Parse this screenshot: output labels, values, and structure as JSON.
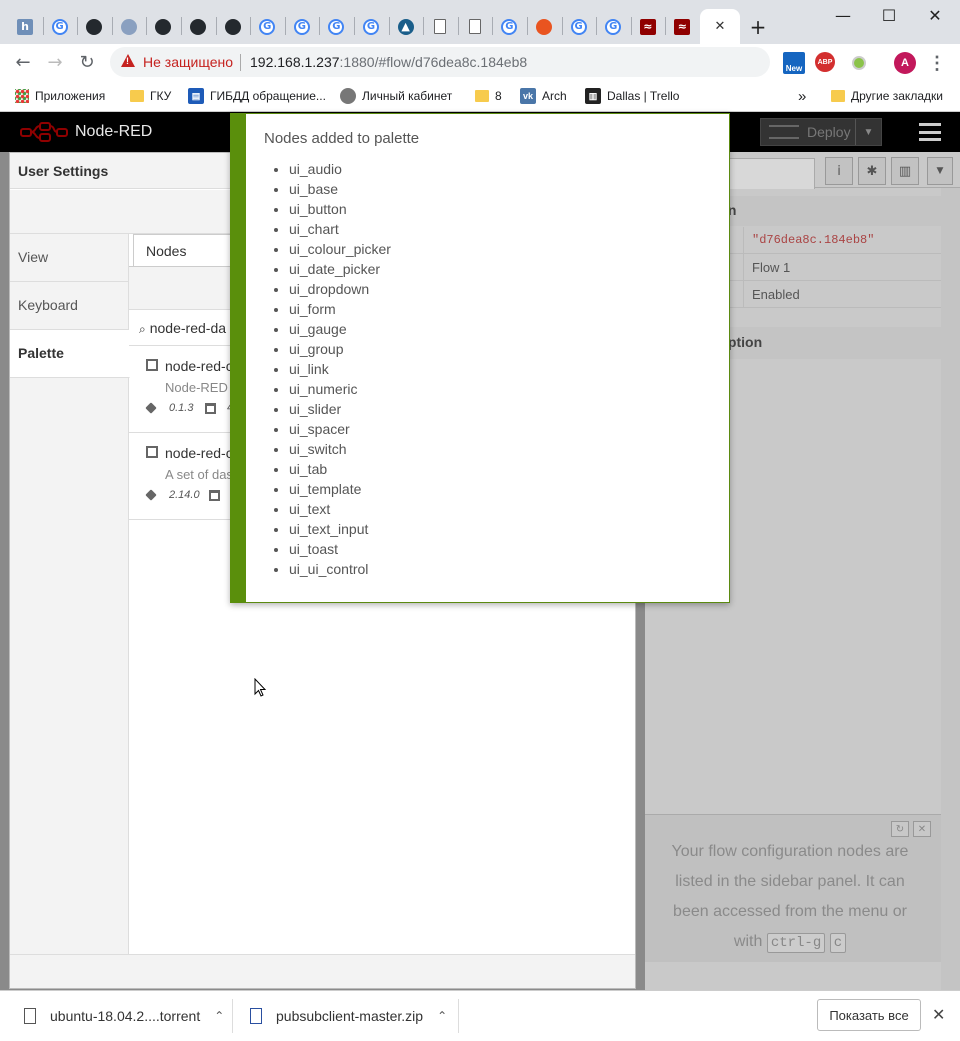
{
  "browser": {
    "tabs": [
      {
        "icon": "h-icon"
      },
      {
        "icon": "google-icon"
      },
      {
        "icon": "github-icon"
      },
      {
        "icon": "planet-icon"
      },
      {
        "icon": "github-icon"
      },
      {
        "icon": "github-icon"
      },
      {
        "icon": "github-icon"
      },
      {
        "icon": "google-icon"
      },
      {
        "icon": "google-icon"
      },
      {
        "icon": "google-icon"
      },
      {
        "icon": "google-icon"
      },
      {
        "icon": "mountain-icon"
      },
      {
        "icon": "document-icon"
      },
      {
        "icon": "document-icon"
      },
      {
        "icon": "google-icon"
      },
      {
        "icon": "ubuntu-icon"
      },
      {
        "icon": "google-icon"
      },
      {
        "icon": "google-icon"
      },
      {
        "icon": "node-red-icon"
      },
      {
        "icon": "node-red-icon"
      }
    ],
    "new_tab_symbol": "+",
    "close_tab_symbol": "✕",
    "window_controls": {
      "minimize": "—",
      "maximize": "☐",
      "close": "✕"
    },
    "security_label": "Не защищено",
    "url_host": "192.168.1.237",
    "url_rest": ":1880/#flow/d76dea8c.184eb8",
    "extension_badge_new": "New",
    "extension_abp": "ABP",
    "profile_initial": "A",
    "bookmarks": [
      {
        "label": "Приложения",
        "icon": "apps-grid-icon"
      },
      {
        "label": "ГКУ",
        "icon": "folder-icon"
      },
      {
        "label": "ГИБДД обращение...",
        "icon": "gibdd-icon"
      },
      {
        "label": "Личный кабинет",
        "icon": "car-icon"
      },
      {
        "label": "8",
        "icon": "folder-icon"
      },
      {
        "label": "Arch",
        "icon": "vk-icon"
      },
      {
        "label": "Dallas | Trello",
        "icon": "trello-icon"
      }
    ],
    "bookmarks_overflow": "»",
    "other_bookmarks": "Другие закладки"
  },
  "nodered": {
    "title": "Node-RED",
    "deploy_label": "Deploy"
  },
  "settings": {
    "title": "User Settings",
    "tabs": [
      "View",
      "Keyboard",
      "Palette"
    ],
    "active_tab": "Palette",
    "nodes_tab": "Nodes",
    "search_value": "node-red-da",
    "packages": [
      {
        "name": "node-red-c",
        "desc": "Node-RED",
        "version": "0.1.3",
        "date": "4"
      },
      {
        "name": "node-red-c",
        "desc": "A set of das",
        "version": "2.14.0",
        "date": ""
      }
    ]
  },
  "sidebar": {
    "section_info": "ation",
    "rows": [
      {
        "value": "\"d76dea8c.184eb8\""
      },
      {
        "value": "Flow 1"
      },
      {
        "value": "Enabled"
      }
    ],
    "section_description": "scription",
    "help_text": "Your flow configuration nodes are listed in the sidebar panel. It can been accessed from the menu or with",
    "kbd_1": "ctrl-g",
    "kbd_2": "c"
  },
  "notification": {
    "title": "Nodes added to palette",
    "nodes": [
      "ui_audio",
      "ui_base",
      "ui_button",
      "ui_chart",
      "ui_colour_picker",
      "ui_date_picker",
      "ui_dropdown",
      "ui_form",
      "ui_gauge",
      "ui_group",
      "ui_link",
      "ui_numeric",
      "ui_slider",
      "ui_spacer",
      "ui_switch",
      "ui_tab",
      "ui_template",
      "ui_text",
      "ui_text_input",
      "ui_toast",
      "ui_ui_control"
    ],
    "accent_color": "#5a8f0c"
  },
  "downloads": {
    "items": [
      "ubuntu-18.04.2....torrent",
      "pubsubclient-master.zip"
    ],
    "show_all": "Показать все"
  }
}
